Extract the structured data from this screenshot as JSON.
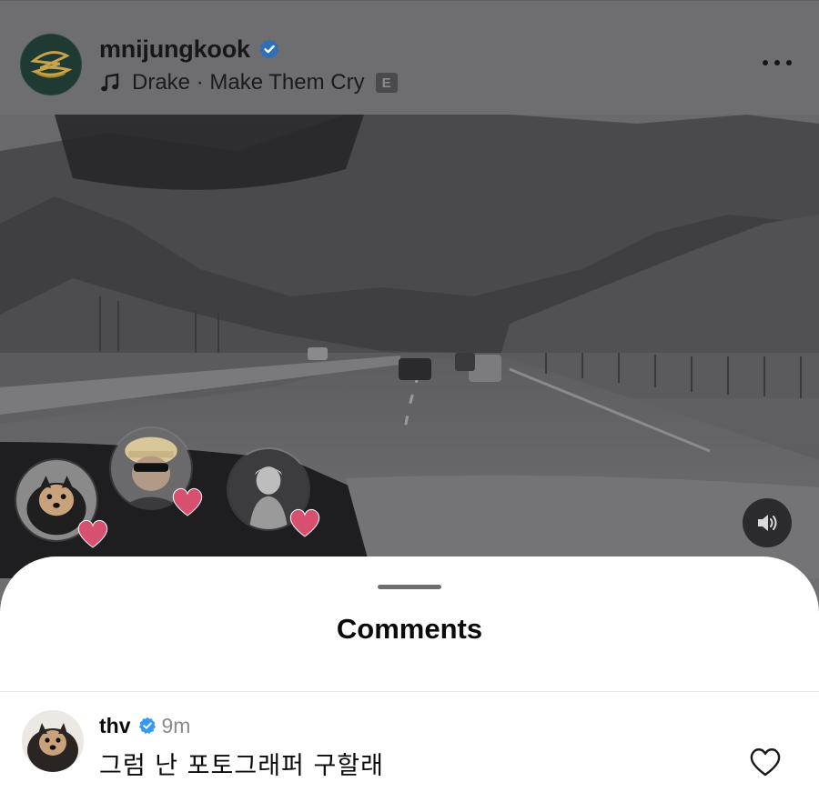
{
  "post": {
    "username": "mnijungkook",
    "verified": true,
    "music": {
      "icon": "music-note-icon",
      "text": "Drake · Make Them Cry",
      "explicit_label": "E"
    },
    "more_icon": "more-horizontal-icon"
  },
  "video": {
    "sound_icon": "speaker-sound-icon",
    "reactions": [
      {
        "name": "dog-avatar",
        "reaction": "heart"
      },
      {
        "name": "hat-sunglasses-avatar",
        "reaction": "heart"
      },
      {
        "name": "portrait-avatar",
        "reaction": "heart"
      }
    ]
  },
  "comments_sheet": {
    "title": "Comments",
    "comments": [
      {
        "user": "thv",
        "verified": true,
        "time": "9m",
        "text": "그럼 난 포토그래퍼 구할래",
        "like_icon": "heart-outline-icon"
      }
    ]
  },
  "colors": {
    "verified_blue": "#3897f0",
    "heart_pink": "#e8507a",
    "sheet_bg": "#ffffff",
    "overlay_gray": "#6e6e71"
  }
}
